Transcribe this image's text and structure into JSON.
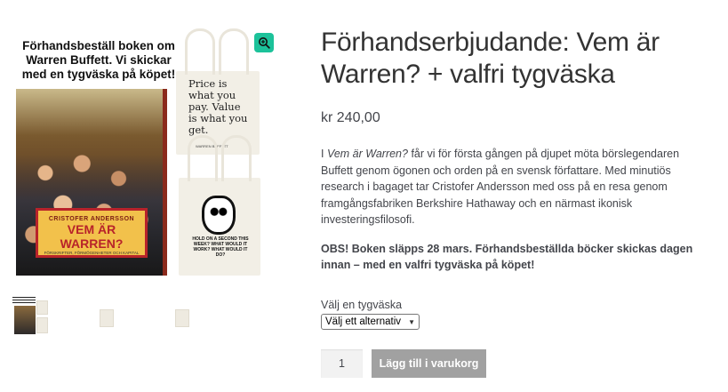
{
  "gallery": {
    "promo_heading": "Förhandsbeställ boken om Warren Buffett. Vi skickar med en tygväska på köpet!",
    "book": {
      "author": "CRISTOFER ANDERSSON",
      "title": "VEM ÄR WARREN?",
      "subtitle": "FÖRSKRIFTER, FÖRMÖGENHETER OCH KAPITAL"
    },
    "bag_top": {
      "quote": "Price is what you pay. Value is what you get.",
      "signature": "WARREN BUFFETT"
    },
    "bag_bottom": {
      "caption": "HOLD ON A SECOND THIS WEEK? WHAT WOULD IT WORK? WHAT WOULD IT DO?"
    },
    "zoom_icon": "magnifier-plus-icon",
    "accent_color": "#1cc29a",
    "thumbnails": [
      {
        "name": "thumbnail-book-and-bags",
        "active": true
      },
      {
        "name": "thumbnail-quote-bag",
        "active": false
      },
      {
        "name": "thumbnail-face-bag",
        "active": false
      }
    ]
  },
  "product": {
    "title": "Förhandserbjudande: Vem är Warren? + valfri tygväska",
    "price": "kr 240,00",
    "description": {
      "lead": "I ",
      "italic_title": "Vem är Warren?",
      "body": " får vi för första gången på djupet möta börslegendaren Buffett genom ögonen och orden på en svensk författare. Med minutiös research i bagaget tar Cristofer Andersson med oss på en resa genom framgångsfabriken Berkshire Hathaway och en närmast ikonisk investeringsfilosofi."
    },
    "notice": "OBS! Boken släpps 28 mars. Förhandsbeställda böcker skickas dagen innan – med en valfri tygväska på köpet!"
  },
  "variation": {
    "label": "Välj en tygväska",
    "selected": "Välj ett alternativ"
  },
  "cart": {
    "quantity": "1",
    "add_button": "Lägg till i varukorg",
    "button_color": "#a1a1a1"
  }
}
